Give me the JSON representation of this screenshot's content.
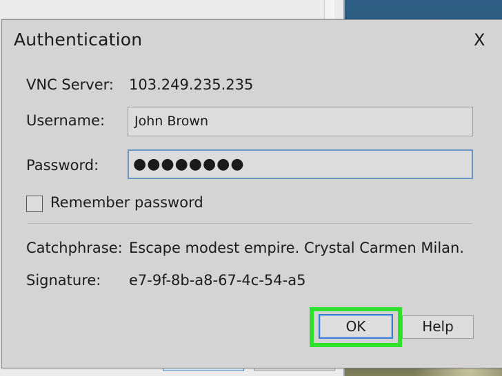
{
  "dialog": {
    "title": "Authentication",
    "close_glyph": "X",
    "close_icon": "close-icon"
  },
  "server": {
    "label": "VNC Server:",
    "value": "103.249.235.235"
  },
  "username": {
    "label": "Username:",
    "value": "John Brown"
  },
  "password": {
    "label": "Password:",
    "masked_value": "●●●●●●●●"
  },
  "remember": {
    "label": "Remember password",
    "checked": false
  },
  "catchphrase": {
    "label": "Catchphrase:",
    "value": "Escape modest empire. Crystal Carmen Milan."
  },
  "signature": {
    "label": "Signature:",
    "value": "e7-9f-8b-a8-67-4c-54-a5"
  },
  "buttons": {
    "ok_label": "OK",
    "help_label": "Help"
  },
  "colors": {
    "highlight": "#2fe02f",
    "focus_border": "#3c7fd1",
    "dialog_bg": "#d4d4d4"
  }
}
